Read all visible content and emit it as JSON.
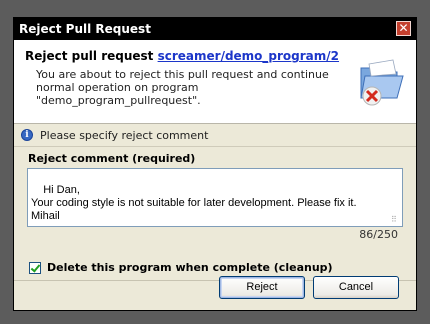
{
  "window": {
    "title": "Reject Pull Request",
    "close_glyph": "✕"
  },
  "header": {
    "title_prefix": "Reject pull request ",
    "pr_link": "screamer/demo_program/2",
    "description": "You are about to reject this pull request and continue normal operation on program \"demo_program_pullrequest\".",
    "icon": "folder-reject-icon"
  },
  "info": {
    "icon_glyph": "i",
    "text": "Please specify reject comment"
  },
  "comment": {
    "label": "Reject comment (required)",
    "value": "Hi Dan,\nYour coding style is not suitable for later development. Please fix it.\nMihail",
    "counter": "86/250"
  },
  "cleanup": {
    "label": "Delete this program when complete (cleanup)",
    "checked": true
  },
  "buttons": {
    "reject": "Reject",
    "cancel": "Cancel"
  },
  "colors": {
    "link": "#1c36c9",
    "dialog_bg": "#ece9d8",
    "close_button": "#c4402e"
  }
}
